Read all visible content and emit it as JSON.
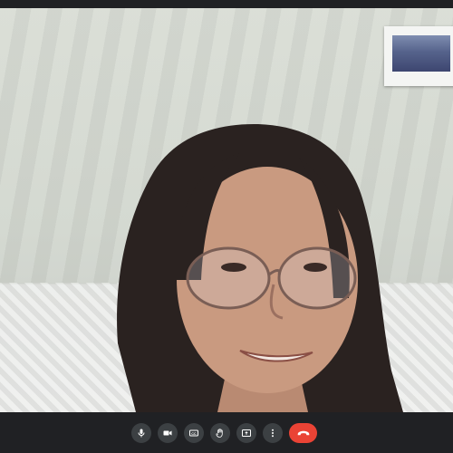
{
  "call": {
    "participant_video": "participant-video",
    "controls": [
      {
        "name": "microphone-button",
        "icon": "microphone-icon"
      },
      {
        "name": "camera-button",
        "icon": "video-camera-icon"
      },
      {
        "name": "captions-button",
        "icon": "closed-captions-icon",
        "glyph": "CC"
      },
      {
        "name": "raise-hand-button",
        "icon": "hand-icon"
      },
      {
        "name": "present-screen-button",
        "icon": "present-screen-icon"
      },
      {
        "name": "more-options-button",
        "icon": "more-vert-icon"
      },
      {
        "name": "leave-call-button",
        "icon": "end-call-icon"
      }
    ]
  },
  "colors": {
    "toolbar_bg": "#202124",
    "button_bg": "#3c4043",
    "end_call": "#ea4335",
    "icon": "#ffffff"
  }
}
